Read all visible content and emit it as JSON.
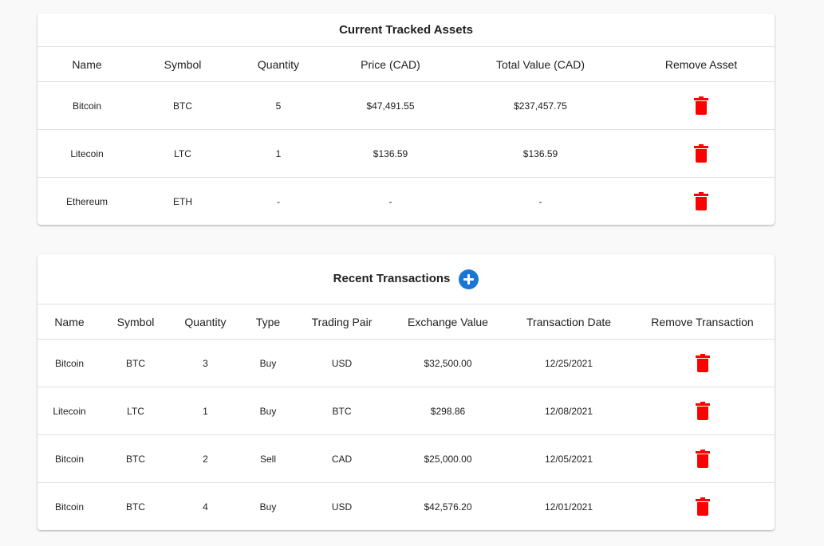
{
  "assets": {
    "title": "Current Tracked Assets",
    "columns": [
      "Name",
      "Symbol",
      "Quantity",
      "Price (CAD)",
      "Total Value (CAD)",
      "Remove Asset"
    ],
    "rows": [
      {
        "name": "Bitcoin",
        "symbol": "BTC",
        "quantity": "5",
        "price": "$47,491.55",
        "total": "$237,457.75"
      },
      {
        "name": "Litecoin",
        "symbol": "LTC",
        "quantity": "1",
        "price": "$136.59",
        "total": "$136.59"
      },
      {
        "name": "Ethereum",
        "symbol": "ETH",
        "quantity": "-",
        "price": "-",
        "total": "-"
      }
    ]
  },
  "transactions": {
    "title": "Recent Transactions",
    "add_icon": "plus-circle-icon",
    "columns": [
      "Name",
      "Symbol",
      "Quantity",
      "Type",
      "Trading Pair",
      "Exchange Value",
      "Transaction Date",
      "Remove Transaction"
    ],
    "rows": [
      {
        "name": "Bitcoin",
        "symbol": "BTC",
        "quantity": "3",
        "type": "Buy",
        "pair": "USD",
        "value": "$32,500.00",
        "date": "12/25/2021"
      },
      {
        "name": "Litecoin",
        "symbol": "LTC",
        "quantity": "1",
        "type": "Buy",
        "pair": "BTC",
        "value": "$298.86",
        "date": "12/08/2021"
      },
      {
        "name": "Bitcoin",
        "symbol": "BTC",
        "quantity": "2",
        "type": "Sell",
        "pair": "CAD",
        "value": "$25,000.00",
        "date": "12/05/2021"
      },
      {
        "name": "Bitcoin",
        "symbol": "BTC",
        "quantity": "4",
        "type": "Buy",
        "pair": "USD",
        "value": "$42,576.20",
        "date": "12/01/2021"
      }
    ]
  },
  "icons": {
    "remove": "trash-icon"
  },
  "colors": {
    "delete": "#ff0000",
    "add": "#1976d2",
    "background": "#f9f9f9"
  }
}
